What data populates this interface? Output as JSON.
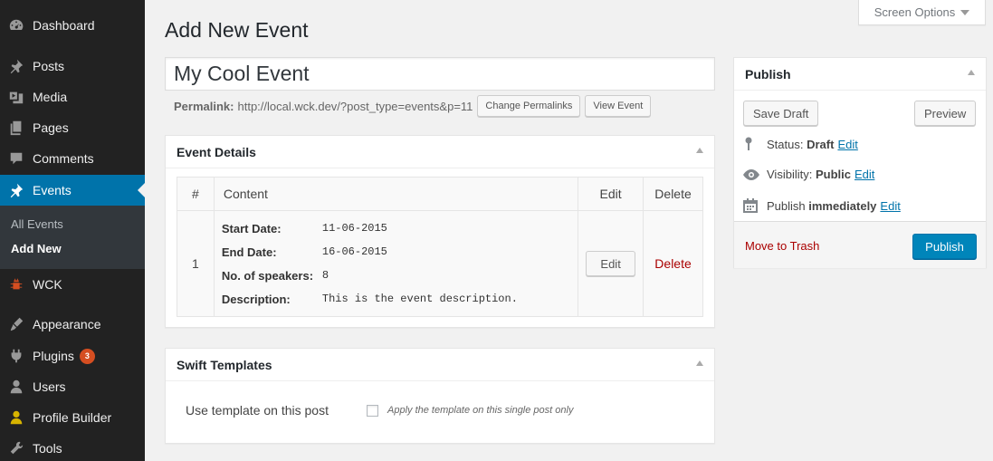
{
  "screen_options": "Screen Options",
  "sidebar": {
    "items": [
      {
        "label": "Dashboard",
        "icon": "dashboard-icon"
      },
      {
        "label": "Posts",
        "icon": "pin-icon"
      },
      {
        "label": "Media",
        "icon": "media-icon"
      },
      {
        "label": "Pages",
        "icon": "pages-icon"
      },
      {
        "label": "Comments",
        "icon": "comment-icon"
      },
      {
        "label": "Events",
        "icon": "pin-icon",
        "active": true
      },
      {
        "label": "WCK",
        "icon": "bug-icon"
      },
      {
        "label": "Appearance",
        "icon": "brush-icon"
      },
      {
        "label": "Plugins",
        "icon": "plugin-icon",
        "badge": "3"
      },
      {
        "label": "Users",
        "icon": "users-icon"
      },
      {
        "label": "Profile Builder",
        "icon": "profile-icon"
      },
      {
        "label": "Tools",
        "icon": "wrench-icon"
      }
    ],
    "submenu": [
      "All Events",
      "Add New"
    ]
  },
  "page_title": "Add New Event",
  "post_title": "My Cool Event",
  "permalink": {
    "label": "Permalink:",
    "url": "http://local.wck.dev/?post_type=events&p=11",
    "change_button": "Change Permalinks",
    "view_button": "View Event"
  },
  "event_details": {
    "heading": "Event Details",
    "columns": [
      "#",
      "Content",
      "Edit",
      "Delete"
    ],
    "rows": [
      {
        "num": "1",
        "fields": [
          {
            "label": "Start Date:",
            "value": "11-06-2015"
          },
          {
            "label": "End Date:",
            "value": "16-06-2015"
          },
          {
            "label": "No. of speakers:",
            "value": "8"
          },
          {
            "label": "Description:",
            "value": "This is the event description."
          }
        ],
        "edit": "Edit",
        "delete": "Delete"
      }
    ]
  },
  "swift_templates": {
    "heading": "Swift Templates",
    "label": "Use template on this post",
    "checkbox_label": "Apply the template on this single post only",
    "checked": false
  },
  "publish": {
    "heading": "Publish",
    "save_draft": "Save Draft",
    "preview": "Preview",
    "status_label": "Status:",
    "status_value": "Draft",
    "visibility_label": "Visibility:",
    "visibility_value": "Public",
    "schedule_label": "Publish",
    "schedule_value": "immediately",
    "edit_link": "Edit",
    "trash": "Move to Trash",
    "publish_button": "Publish"
  },
  "colors": {
    "sidebar_bg": "#222222",
    "active_menu": "#0073aa",
    "publish_button": "#0085ba",
    "delete_link": "#aa0000",
    "badge": "#d54e21"
  }
}
